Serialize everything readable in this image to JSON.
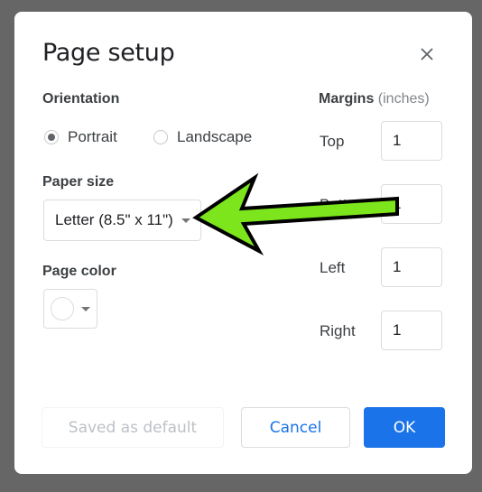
{
  "dialog": {
    "title": "Page setup",
    "close_icon": "close-icon"
  },
  "orientation": {
    "label": "Orientation",
    "options": [
      {
        "label": "Portrait",
        "selected": true
      },
      {
        "label": "Landscape",
        "selected": false
      }
    ]
  },
  "paper_size": {
    "label": "Paper size",
    "value": "Letter (8.5\" x 11\")"
  },
  "page_color": {
    "label": "Page color",
    "value": "#ffffff"
  },
  "margins": {
    "label": "Margins",
    "unit": "(inches)",
    "fields": [
      {
        "label": "Top",
        "value": "1"
      },
      {
        "label": "Bottom",
        "value": "1"
      },
      {
        "label": "Left",
        "value": "1"
      },
      {
        "label": "Right",
        "value": "1"
      }
    ]
  },
  "buttons": {
    "save_default": "Saved as default",
    "cancel": "Cancel",
    "ok": "OK"
  },
  "annotation": {
    "type": "arrow",
    "color": "#7ce51c",
    "points_to": "paper-size-select"
  },
  "colors": {
    "accent": "#1a73e8",
    "backdrop": "#666666"
  }
}
